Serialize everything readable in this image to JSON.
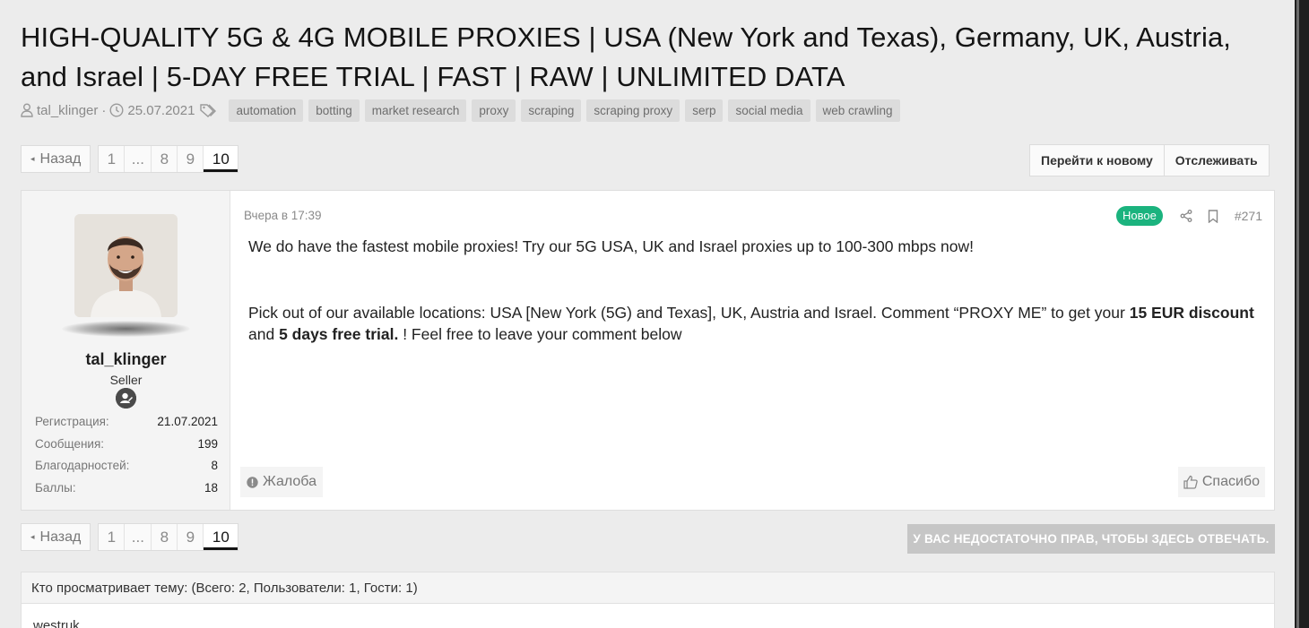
{
  "thread": {
    "title": "HIGH-QUALITY 5G & 4G MOBILE PROXIES | USA (New York and Texas), Germany, UK, Austria, and Israel | 5-DAY FREE TRIAL | FAST | RAW | UNLIMITED DATA",
    "author": "tal_klinger",
    "date": "25.07.2021",
    "tags": [
      "automation",
      "botting",
      "market research",
      "proxy",
      "scraping",
      "scraping proxy",
      "serp",
      "social media",
      "web crawling"
    ]
  },
  "pagination": {
    "prev_label": "Назад",
    "pages": [
      "1",
      "...",
      "8",
      "9",
      "10"
    ],
    "current": "10"
  },
  "thread_actions": {
    "goto_new": "Перейти к новому",
    "watch": "Отслеживать"
  },
  "post": {
    "date": "Вчера в 17:39",
    "new_badge": "Новое",
    "number": "#271",
    "para1": "We do have the fastest mobile proxies! Try our 5G USA, UK and Israel proxies up to 100-300 mbps now!",
    "para2_a": "Pick out of our available locations: USA [New York (5G) and Texas], UK, Austria and Israel. Comment “PROXY ME” to get your ",
    "para2_b": "15 EUR discount",
    "para2_c": " and ",
    "para2_d": "5 days free trial.",
    "para2_e": " ! Feel free to leave your comment below",
    "report_label": "Жалоба",
    "thanks_label": "Спасибо"
  },
  "user": {
    "name": "tal_klinger",
    "role": "Seller",
    "stats": [
      {
        "label": "Регистрация:",
        "value": "21.07.2021"
      },
      {
        "label": "Сообщения:",
        "value": "199"
      },
      {
        "label": "Благодарностей:",
        "value": "8"
      },
      {
        "label": "Баллы:",
        "value": "18"
      }
    ]
  },
  "reply_notice": "У ВАС НЕДОСТАТОЧНО ПРАВ, ЧТОБЫ ЗДЕСЬ ОТВЕЧАТЬ.",
  "viewers": {
    "title": "Кто просматривает тему: (Всего: 2, Пользователи: 1, Гости: 1)",
    "names": "westruk"
  },
  "colors": {
    "accent_new": "#1bb37e",
    "background": "#ececec"
  }
}
